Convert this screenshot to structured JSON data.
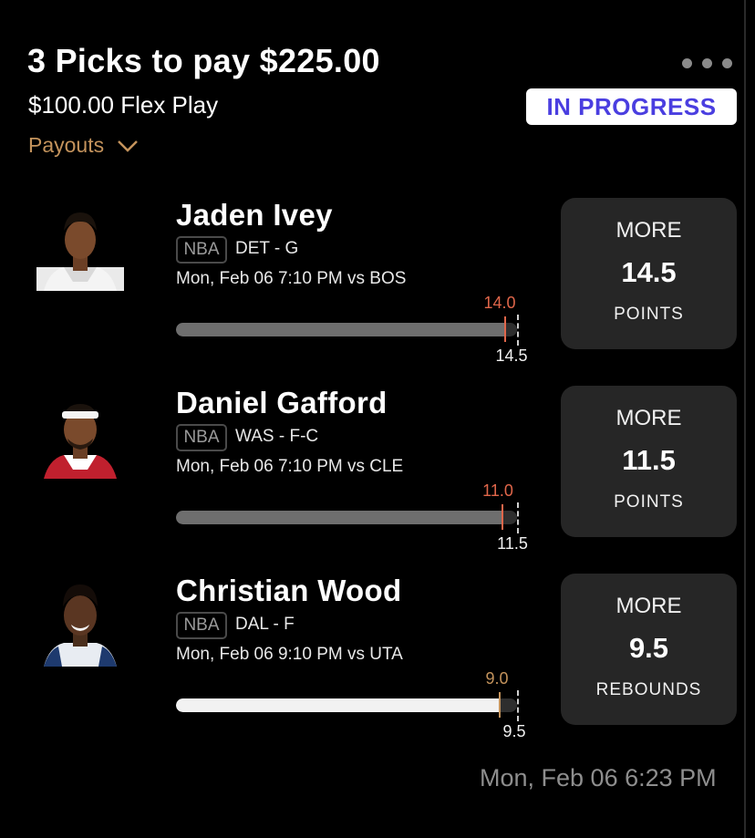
{
  "header": {
    "title": "3 Picks to pay $225.00",
    "subtitle": "$100.00 Flex Play",
    "status": "IN PROGRESS",
    "payouts_label": "Payouts",
    "more_icon": "more-horizontal-icon"
  },
  "picks": [
    {
      "name": "Jaden Ivey",
      "league": "NBA",
      "team_pos": "DET - G",
      "game": "Mon, Feb 06 7:10 PM  vs BOS",
      "direction": "MORE",
      "line": "14.5",
      "stat": "POINTS",
      "actual": "14.0",
      "actual_color": "#e0664a",
      "bar_fill_percent": 96.5
    },
    {
      "name": "Daniel Gafford",
      "league": "NBA",
      "team_pos": "WAS - F-C",
      "game": "Mon, Feb 06 7:10 PM  vs CLE",
      "direction": "MORE",
      "line": "11.5",
      "stat": "POINTS",
      "actual": "11.0",
      "actual_color": "#e0664a",
      "bar_fill_percent": 95.7
    },
    {
      "name": "Christian Wood",
      "league": "NBA",
      "team_pos": "DAL - F",
      "game": "Mon, Feb 06 9:10 PM  vs UTA",
      "direction": "MORE",
      "line": "9.5",
      "stat": "REBOUNDS",
      "actual": "9.0",
      "actual_color": "#c4935c",
      "bar_fill_percent": 94.7
    }
  ],
  "footer": {
    "timestamp": "Mon, Feb 06 6:23 PM"
  }
}
